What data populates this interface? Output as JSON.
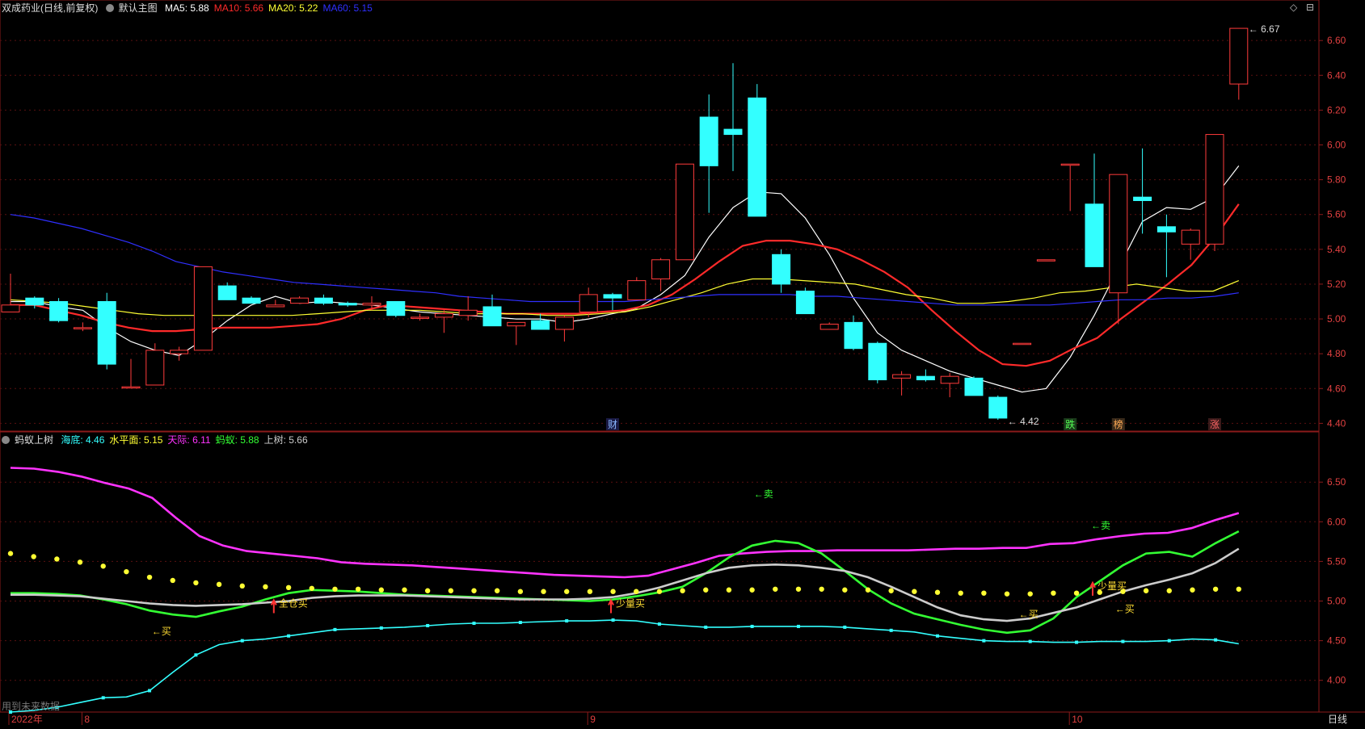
{
  "main_header": {
    "title": "双成药业(日线,前复权)",
    "mode": "默认主图",
    "ma": [
      {
        "label": "MA5:",
        "value": "5.88",
        "color": "#ffffff"
      },
      {
        "label": "MA10:",
        "value": "5.66",
        "color": "#ff2a2a"
      },
      {
        "label": "MA20:",
        "value": "5.22",
        "color": "#ffff33"
      },
      {
        "label": "MA60:",
        "value": "5.15",
        "color": "#2f2fff"
      }
    ]
  },
  "sub_header": {
    "title": "蚂蚁上树",
    "items": [
      {
        "label": "海底:",
        "value": "4.46",
        "color": "#33ffff"
      },
      {
        "label": "水平面:",
        "value": "5.15",
        "color": "#ffff33"
      },
      {
        "label": "天际:",
        "value": "6.11",
        "color": "#ff33ff"
      },
      {
        "label": "蚂蚁:",
        "value": "5.88",
        "color": "#33ff33"
      },
      {
        "label": "上树:",
        "value": "5.66",
        "color": "#cccccc"
      }
    ]
  },
  "top_right_icons": [
    "◇",
    "⊟"
  ],
  "bottom": {
    "tab": "日线",
    "left_note": "用到未来数据"
  },
  "chart_data": [
    {
      "type": "candlestick",
      "name": "双成药业(日线,前复权)",
      "ylim": [
        4.36,
        6.74
      ],
      "yticks": [
        "4.40",
        "4.60",
        "4.80",
        "5.00",
        "5.20",
        "5.40",
        "5.60",
        "5.80",
        "6.00",
        "6.20",
        "6.40",
        "6.60"
      ],
      "up_color": "#ff3b3b",
      "down_color": "#33ffff",
      "candles": [
        {
          "o": 5.04,
          "h": 5.26,
          "l": 5.04,
          "c": 5.08
        },
        {
          "o": 5.12,
          "h": 5.13,
          "l": 5.06,
          "c": 5.08
        },
        {
          "o": 5.1,
          "h": 5.12,
          "l": 4.98,
          "c": 4.99
        },
        {
          "o": 4.95,
          "h": 4.98,
          "l": 4.93,
          "c": 4.95
        },
        {
          "o": 5.1,
          "h": 5.15,
          "l": 4.71,
          "c": 4.74
        },
        {
          "o": 4.61,
          "h": 4.77,
          "l": 4.61,
          "c": 4.61
        },
        {
          "o": 4.62,
          "h": 4.86,
          "l": 4.62,
          "c": 4.82
        },
        {
          "o": 4.8,
          "h": 4.84,
          "l": 4.76,
          "c": 4.82
        },
        {
          "o": 4.82,
          "h": 5.3,
          "l": 4.82,
          "c": 5.3
        },
        {
          "o": 5.19,
          "h": 5.21,
          "l": 5.11,
          "c": 5.11
        },
        {
          "o": 5.12,
          "h": 5.13,
          "l": 5.09,
          "c": 5.09
        },
        {
          "o": 5.07,
          "h": 5.11,
          "l": 5.07,
          "c": 5.08
        },
        {
          "o": 5.09,
          "h": 5.13,
          "l": 5.09,
          "c": 5.12
        },
        {
          "o": 5.12,
          "h": 5.14,
          "l": 5.08,
          "c": 5.09
        },
        {
          "o": 5.09,
          "h": 5.1,
          "l": 5.07,
          "c": 5.08
        },
        {
          "o": 5.08,
          "h": 5.13,
          "l": 5.05,
          "c": 5.09
        },
        {
          "o": 5.1,
          "h": 5.1,
          "l": 5.01,
          "c": 5.02
        },
        {
          "o": 5.01,
          "h": 5.03,
          "l": 4.99,
          "c": 5.01
        },
        {
          "o": 5.01,
          "h": 5.05,
          "l": 4.92,
          "c": 5.03
        },
        {
          "o": 5.02,
          "h": 5.13,
          "l": 4.99,
          "c": 5.05
        },
        {
          "o": 5.07,
          "h": 5.14,
          "l": 4.96,
          "c": 4.96
        },
        {
          "o": 4.96,
          "h": 4.97,
          "l": 4.85,
          "c": 4.98
        },
        {
          "o": 4.99,
          "h": 5.03,
          "l": 4.94,
          "c": 4.94
        },
        {
          "o": 4.94,
          "h": 5.02,
          "l": 4.87,
          "c": 5.01
        },
        {
          "o": 5.04,
          "h": 5.18,
          "l": 5.01,
          "c": 5.14
        },
        {
          "o": 5.14,
          "h": 5.15,
          "l": 5.05,
          "c": 5.12
        },
        {
          "o": 5.11,
          "h": 5.24,
          "l": 5.11,
          "c": 5.22
        },
        {
          "o": 5.23,
          "h": 5.35,
          "l": 5.16,
          "c": 5.34
        },
        {
          "o": 5.34,
          "h": 5.89,
          "l": 5.34,
          "c": 5.89
        },
        {
          "o": 6.16,
          "h": 6.29,
          "l": 5.61,
          "c": 5.88
        },
        {
          "o": 6.09,
          "h": 6.47,
          "l": 5.85,
          "c": 6.06
        },
        {
          "o": 6.27,
          "h": 6.35,
          "l": 5.59,
          "c": 5.59
        },
        {
          "o": 5.37,
          "h": 5.4,
          "l": 5.15,
          "c": 5.2
        },
        {
          "o": 5.16,
          "h": 5.18,
          "l": 5.03,
          "c": 5.03
        },
        {
          "o": 4.94,
          "h": 4.98,
          "l": 4.94,
          "c": 4.97
        },
        {
          "o": 4.98,
          "h": 5.02,
          "l": 4.82,
          "c": 4.83
        },
        {
          "o": 4.86,
          "h": 4.87,
          "l": 4.63,
          "c": 4.65
        },
        {
          "o": 4.66,
          "h": 4.7,
          "l": 4.56,
          "c": 4.68
        },
        {
          "o": 4.67,
          "h": 4.71,
          "l": 4.64,
          "c": 4.65
        },
        {
          "o": 4.63,
          "h": 4.69,
          "l": 4.55,
          "c": 4.67
        },
        {
          "o": 4.66,
          "h": 4.67,
          "l": 4.56,
          "c": 4.56
        },
        {
          "o": 4.55,
          "h": 4.56,
          "l": 4.42,
          "c": 4.43
        },
        {
          "o": 4.86,
          "h": 4.86,
          "l": 4.86,
          "c": 4.86
        },
        {
          "o": 5.34,
          "h": 5.34,
          "l": 5.34,
          "c": 5.34
        },
        {
          "o": 5.89,
          "h": 5.89,
          "l": 5.62,
          "c": 5.89
        },
        {
          "o": 5.66,
          "h": 5.95,
          "l": 5.3,
          "c": 5.3
        },
        {
          "o": 5.15,
          "h": 5.83,
          "l": 4.97,
          "c": 5.83
        },
        {
          "o": 5.7,
          "h": 5.98,
          "l": 5.49,
          "c": 5.68
        },
        {
          "o": 5.53,
          "h": 5.6,
          "l": 5.24,
          "c": 5.5
        },
        {
          "o": 5.43,
          "h": 5.52,
          "l": 5.34,
          "c": 5.51
        },
        {
          "o": 5.43,
          "h": 6.06,
          "l": 5.39,
          "c": 6.06
        },
        {
          "o": 6.35,
          "h": 6.67,
          "l": 6.26,
          "c": 6.67
        }
      ],
      "ma_series": [
        {
          "name": "MA5",
          "color": "#ffffff",
          "values": [
            5.1,
            5.1,
            5.07,
            5.05,
            4.95,
            4.87,
            4.82,
            4.79,
            4.88,
            4.99,
            5.08,
            5.13,
            5.09,
            5.1,
            5.09,
            5.08,
            5.06,
            5.04,
            5.03,
            5.02,
            5.01,
            5.0,
            5.0,
            4.98,
            5.0,
            5.03,
            5.06,
            5.14,
            5.25,
            5.47,
            5.64,
            5.73,
            5.72,
            5.58,
            5.37,
            5.12,
            4.92,
            4.82,
            4.76,
            4.7,
            4.66,
            4.62,
            4.58,
            4.6,
            4.78,
            5.02,
            5.29,
            5.56,
            5.64,
            5.63,
            5.7,
            5.88
          ]
        },
        {
          "name": "MA10",
          "color": "#ff2a2a",
          "values": [
            5.08,
            5.08,
            5.05,
            5.02,
            4.98,
            4.95,
            4.93,
            4.93,
            4.94,
            4.95,
            4.95,
            4.95,
            4.96,
            4.97,
            5.0,
            5.05,
            5.08,
            5.07,
            5.06,
            5.05,
            5.04,
            5.03,
            5.03,
            5.03,
            5.03,
            5.04,
            5.05,
            5.08,
            5.14,
            5.23,
            5.33,
            5.42,
            5.45,
            5.45,
            5.43,
            5.4,
            5.34,
            5.27,
            5.18,
            5.05,
            4.93,
            4.82,
            4.74,
            4.73,
            4.76,
            4.83,
            4.89,
            5.0,
            5.1,
            5.2,
            5.31,
            5.47,
            5.66
          ]
        },
        {
          "name": "MA20",
          "color": "#ffff33",
          "values": [
            5.11,
            5.1,
            5.09,
            5.07,
            5.05,
            5.03,
            5.02,
            5.02,
            5.02,
            5.02,
            5.02,
            5.02,
            5.03,
            5.04,
            5.05,
            5.05,
            5.05,
            5.04,
            5.03,
            5.03,
            5.03,
            5.02,
            5.02,
            5.03,
            5.04,
            5.07,
            5.11,
            5.15,
            5.2,
            5.23,
            5.23,
            5.22,
            5.21,
            5.2,
            5.17,
            5.14,
            5.12,
            5.09,
            5.09,
            5.1,
            5.12,
            5.15,
            5.16,
            5.18,
            5.2,
            5.18,
            5.16,
            5.16,
            5.22
          ]
        },
        {
          "name": "MA60",
          "color": "#2f2fff",
          "values": [
            5.6,
            5.58,
            5.55,
            5.52,
            5.48,
            5.44,
            5.39,
            5.33,
            5.3,
            5.27,
            5.25,
            5.23,
            5.21,
            5.2,
            5.19,
            5.18,
            5.17,
            5.16,
            5.15,
            5.13,
            5.12,
            5.11,
            5.1,
            5.1,
            5.1,
            5.1,
            5.1,
            5.11,
            5.12,
            5.13,
            5.14,
            5.14,
            5.14,
            5.14,
            5.13,
            5.13,
            5.12,
            5.11,
            5.1,
            5.09,
            5.08,
            5.08,
            5.08,
            5.08,
            5.08,
            5.09,
            5.1,
            5.11,
            5.11,
            5.12,
            5.12,
            5.13,
            5.15
          ]
        }
      ],
      "annotations": [
        {
          "text": "4.42",
          "color": "#dddddd"
        },
        {
          "text": "6.67",
          "color": "#dddddd"
        }
      ],
      "markers": [
        {
          "text": "财",
          "color": "#8ab8ff",
          "bg": "#1a1a44"
        },
        {
          "text": "跌",
          "color": "#55ff55",
          "bg": "#1a3a1a"
        },
        {
          "text": "榜",
          "color": "#ffaa55",
          "bg": "#3a2a1a"
        },
        {
          "text": "涨",
          "color": "#ff6666",
          "bg": "#3a1a1a"
        }
      ]
    },
    {
      "type": "line",
      "name": "蚂蚁上树",
      "ylim": [
        3.6,
        6.95
      ],
      "yticks": [
        "4.00",
        "4.50",
        "5.00",
        "5.50",
        "6.00",
        "6.50"
      ],
      "series": [
        {
          "name": "天际",
          "color": "#ff33ff",
          "values": [
            6.68,
            6.67,
            6.63,
            6.57,
            6.49,
            6.42,
            6.3,
            6.05,
            5.82,
            5.7,
            5.63,
            5.6,
            5.57,
            5.54,
            5.49,
            5.47,
            5.46,
            5.45,
            5.43,
            5.41,
            5.39,
            5.37,
            5.35,
            5.33,
            5.32,
            5.31,
            5.3,
            5.32,
            5.4,
            5.48,
            5.57,
            5.6,
            5.62,
            5.63,
            5.63,
            5.64,
            5.64,
            5.64,
            5.64,
            5.65,
            5.66,
            5.66,
            5.67,
            5.67,
            5.72,
            5.73,
            5.78,
            5.82,
            5.85,
            5.86,
            5.92,
            6.02,
            6.11
          ]
        },
        {
          "name": "蚂蚁",
          "color": "#33ff33",
          "values": [
            5.1,
            5.1,
            5.09,
            5.07,
            5.02,
            4.96,
            4.88,
            4.83,
            4.8,
            4.87,
            4.93,
            5.02,
            5.1,
            5.14,
            5.13,
            5.12,
            5.1,
            5.08,
            5.07,
            5.06,
            5.05,
            5.04,
            5.03,
            5.02,
            5.01,
            5.0,
            5.02,
            5.06,
            5.11,
            5.18,
            5.35,
            5.55,
            5.7,
            5.76,
            5.73,
            5.6,
            5.38,
            5.15,
            4.97,
            4.84,
            4.77,
            4.7,
            4.64,
            4.6,
            4.63,
            4.78,
            5.05,
            5.25,
            5.45,
            5.6,
            5.62,
            5.56,
            5.73,
            5.88
          ]
        },
        {
          "name": "上树",
          "color": "#cccccc",
          "values": [
            5.08,
            5.08,
            5.07,
            5.06,
            5.03,
            5.0,
            4.97,
            4.95,
            4.94,
            4.95,
            4.96,
            4.98,
            5.0,
            5.04,
            5.06,
            5.07,
            5.07,
            5.07,
            5.06,
            5.05,
            5.04,
            5.03,
            5.02,
            5.02,
            5.02,
            5.03,
            5.05,
            5.1,
            5.17,
            5.26,
            5.35,
            5.42,
            5.45,
            5.46,
            5.45,
            5.42,
            5.38,
            5.3,
            5.18,
            5.05,
            4.92,
            4.82,
            4.77,
            4.75,
            4.78,
            4.85,
            4.92,
            5.02,
            5.12,
            5.2,
            5.27,
            5.35,
            5.48,
            5.66
          ]
        },
        {
          "name": "海底",
          "color": "#33ffff",
          "values": [
            3.6,
            3.62,
            3.66,
            3.72,
            3.78,
            3.79,
            3.87,
            4.1,
            4.32,
            4.45,
            4.5,
            4.52,
            4.56,
            4.6,
            4.64,
            4.65,
            4.66,
            4.67,
            4.69,
            4.71,
            4.72,
            4.72,
            4.73,
            4.74,
            4.75,
            4.75,
            4.76,
            4.75,
            4.71,
            4.69,
            4.67,
            4.67,
            4.68,
            4.68,
            4.68,
            4.68,
            4.67,
            4.65,
            4.63,
            4.61,
            4.56,
            4.53,
            4.5,
            4.49,
            4.49,
            4.48,
            4.48,
            4.49,
            4.49,
            4.49,
            4.5,
            4.52,
            4.51,
            4.46
          ]
        },
        {
          "name": "水平面",
          "color": "#ffff33",
          "style": "dots",
          "values": [
            5.6,
            5.56,
            5.53,
            5.49,
            5.44,
            5.37,
            5.3,
            5.26,
            5.23,
            5.21,
            5.19,
            5.18,
            5.17,
            5.16,
            5.15,
            5.15,
            5.14,
            5.14,
            5.13,
            5.13,
            5.13,
            5.13,
            5.12,
            5.12,
            5.12,
            5.12,
            5.12,
            5.12,
            5.12,
            5.13,
            5.14,
            5.14,
            5.14,
            5.15,
            5.15,
            5.15,
            5.14,
            5.14,
            5.13,
            5.12,
            5.11,
            5.1,
            5.1,
            5.09,
            5.09,
            5.1,
            5.1,
            5.11,
            5.12,
            5.13,
            5.13,
            5.14,
            5.15,
            5.15
          ]
        }
      ],
      "signals": [
        {
          "text": "←买",
          "color": "#ffdd33",
          "at": 6,
          "y": 4.62
        },
        {
          "text": "全仓买",
          "color": "#ffdd33",
          "at": 11,
          "y": 4.97,
          "arrow": true
        },
        {
          "text": "←卖",
          "color": "#33ff33",
          "at": 31,
          "y": 6.35
        },
        {
          "text": "少量买",
          "color": "#ffdd33",
          "at": 25,
          "y": 4.97,
          "arrow": true
        },
        {
          "text": "←买",
          "color": "#ffdd33",
          "at": 42,
          "y": 4.83
        },
        {
          "text": "←卖",
          "color": "#33ff33",
          "at": 45,
          "y": 5.95
        },
        {
          "text": "少量买",
          "color": "#ffdd33",
          "at": 45,
          "y": 5.19,
          "arrow": true
        },
        {
          "text": "←买",
          "color": "#ffdd33",
          "at": 46,
          "y": 4.9
        }
      ]
    }
  ],
  "x_axis_labels": [
    "2022年",
    "8",
    "9",
    "10"
  ]
}
